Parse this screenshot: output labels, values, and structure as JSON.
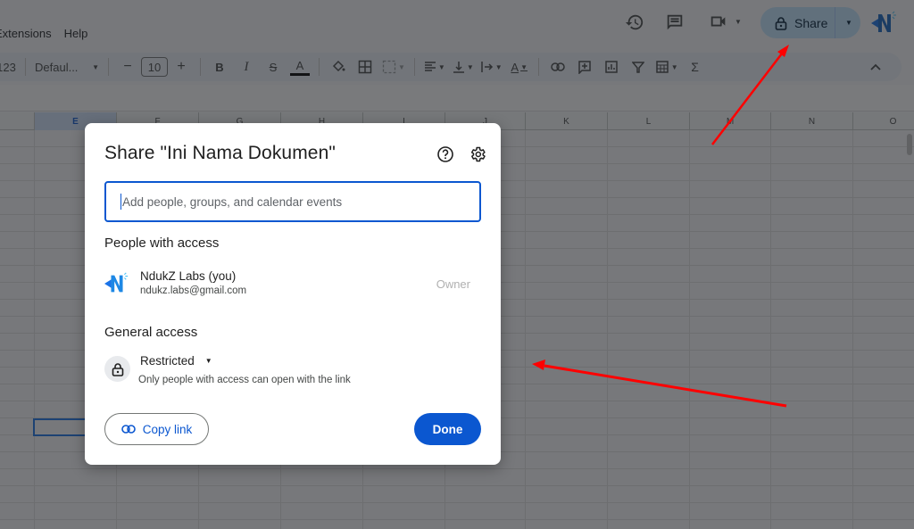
{
  "menubar": {
    "items": [
      "Extensions",
      "Help"
    ]
  },
  "topbar": {
    "share_label": "Share",
    "icons": [
      "history-icon",
      "comment-icon",
      "meet-icon",
      "lock-icon",
      "avatar"
    ]
  },
  "toolbar": {
    "number_format": "123",
    "font": "Defaul...",
    "font_size": "10",
    "decrease": "−",
    "increase": "+",
    "bold": "B",
    "italic": "I",
    "strike": "S",
    "text_color": "A",
    "rotate": "A",
    "functions": "Σ"
  },
  "sheet": {
    "columns": [
      "E",
      "F",
      "G",
      "H",
      "I",
      "J",
      "K",
      "L",
      "M",
      "N",
      "O"
    ],
    "selected_column": "E"
  },
  "dialog": {
    "title": "Share \"Ini Nama Dokumen\"",
    "input_placeholder": "Add people, groups, and calendar events",
    "people_heading": "People with access",
    "person": {
      "name": "NdukZ Labs (you)",
      "email": "ndukz.labs@gmail.com",
      "role": "Owner"
    },
    "general_heading": "General access",
    "access_level": "Restricted",
    "access_description": "Only people with access can open with the link",
    "copy_link_label": "Copy link",
    "done_label": "Done"
  },
  "colors": {
    "accent": "#0b57d0",
    "share_bg": "#c2e7ff",
    "annotation": "#ff0000"
  }
}
